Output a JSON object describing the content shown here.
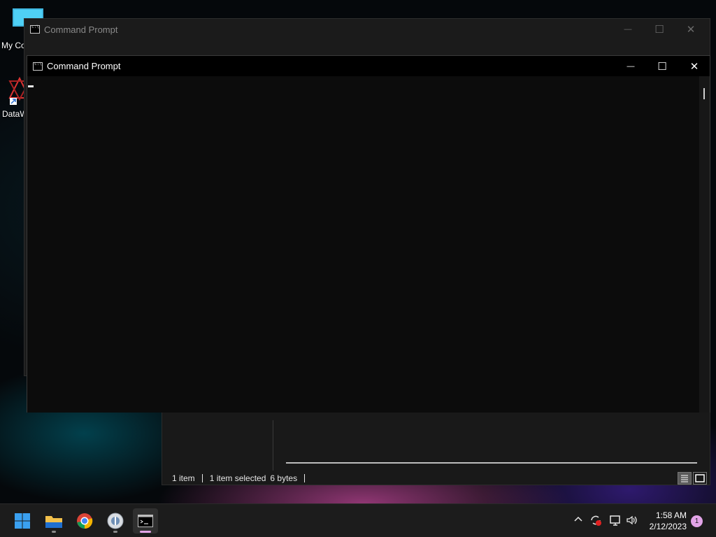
{
  "desktop": {
    "icons": [
      {
        "label": "My Co",
        "icon": "monitor-icon"
      },
      {
        "label": "DataW",
        "icon": "datawrapper-shortcut-icon"
      }
    ]
  },
  "cmd_back": {
    "title": "Command Prompt",
    "controls": {
      "minimize": "—",
      "maximize": "☐",
      "close": "✕"
    }
  },
  "cmd_front": {
    "title": "Command Prompt",
    "controls": {
      "minimize": "—",
      "maximize": "☐",
      "close": "✕"
    },
    "content": ""
  },
  "explorer": {
    "status": {
      "items": "1 item",
      "selected": "1 item selected",
      "size": "6 bytes"
    }
  },
  "taskbar": {
    "apps": [
      {
        "name": "start",
        "icon": "windows-start-icon"
      },
      {
        "name": "file-explorer",
        "icon": "folder-icon"
      },
      {
        "name": "chrome",
        "icon": "chrome-icon"
      },
      {
        "name": "app",
        "icon": "globe-app-icon"
      },
      {
        "name": "command-prompt",
        "icon": "terminal-icon"
      }
    ],
    "tray": {
      "time": "1:58 AM",
      "date": "2/12/2023",
      "notifications": "1"
    }
  },
  "colors": {
    "accent": "#e2a4e7",
    "taskbar": "#1c1c1c",
    "console_bg": "#0c0c0c"
  }
}
